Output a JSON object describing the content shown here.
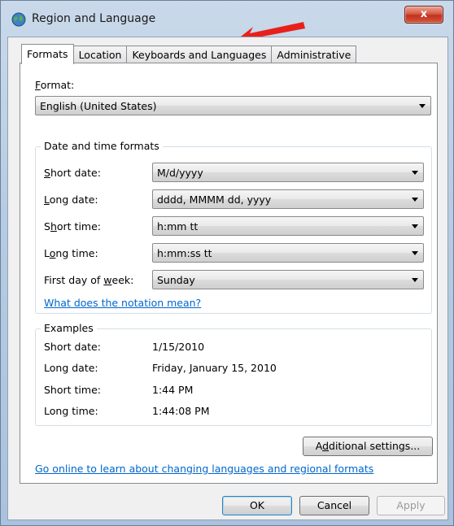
{
  "window": {
    "title": "Region and Language",
    "close_label": "x"
  },
  "tabs": [
    {
      "label": "Formats",
      "active": true
    },
    {
      "label": "Location",
      "active": false
    },
    {
      "label": "Keyboards and Languages",
      "active": false
    },
    {
      "label": "Administrative",
      "active": false
    }
  ],
  "format": {
    "label_mnemonic": "F",
    "label_rest": "ormat:",
    "value": "English (United States)"
  },
  "date_time_formats": {
    "group_title": "Date and time formats",
    "rows": [
      {
        "label_pre": "",
        "mnemonic": "S",
        "label_post": "hort date:",
        "value": "M/d/yyyy"
      },
      {
        "label_pre": "",
        "mnemonic": "L",
        "label_post": "ong date:",
        "value": "dddd, MMMM dd, yyyy"
      },
      {
        "label_pre": "S",
        "mnemonic": "h",
        "label_post": "ort time:",
        "value": "h:mm tt"
      },
      {
        "label_pre": "L",
        "mnemonic": "o",
        "label_post": "ng time:",
        "value": "h:mm:ss tt"
      },
      {
        "label_pre": "First day of ",
        "mnemonic": "w",
        "label_post": "eek:",
        "value": "Sunday"
      }
    ],
    "notation_link": "What does the notation mean?"
  },
  "examples": {
    "group_title": "Examples",
    "rows": [
      {
        "label": "Short date:",
        "value": "1/15/2010"
      },
      {
        "label": "Long date:",
        "value": "Friday, January 15, 2010"
      },
      {
        "label": "Short time:",
        "value": "1:44 PM"
      },
      {
        "label": "Long time:",
        "value": "1:44:08 PM"
      }
    ]
  },
  "additional_settings": {
    "mnemonic": "d",
    "pre": "A",
    "post": "ditional settings..."
  },
  "online_link": "Go online to learn about changing languages and regional formats",
  "buttons": {
    "ok": "OK",
    "cancel": "Cancel",
    "apply": "Apply"
  },
  "annotation": {
    "color": "#e8201a"
  }
}
